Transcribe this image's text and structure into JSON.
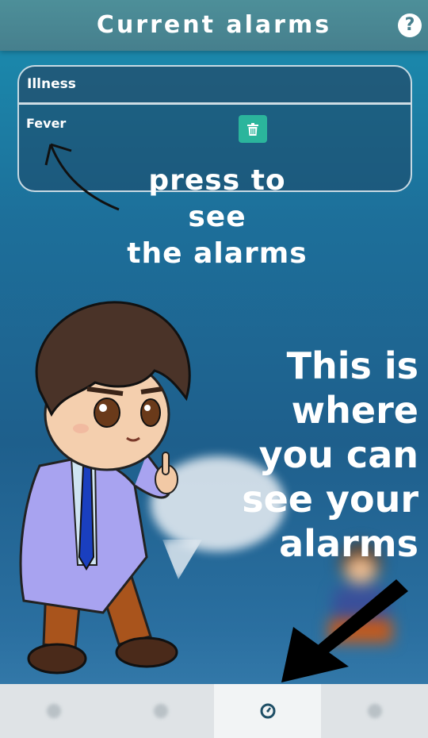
{
  "header": {
    "title": "Current alarms",
    "help_icon": "help-icon",
    "help_glyph": "?"
  },
  "card": {
    "section_title": "Illness",
    "alarms": [
      {
        "name": "Fever",
        "delete_icon": "trash-icon"
      }
    ]
  },
  "tutorial": {
    "hint_line1": "press to see",
    "hint_line2": "the alarms",
    "big_line1": "This is",
    "big_line2": "where",
    "big_line3": "you can",
    "big_line4": "see your",
    "big_line5": "alarms"
  },
  "bottom_nav": {
    "items": [
      {
        "icon": "home-icon",
        "active": false
      },
      {
        "icon": "calendar-icon",
        "active": false
      },
      {
        "icon": "alarm-clock-icon",
        "active": true
      },
      {
        "icon": "settings-icon",
        "active": false
      }
    ]
  },
  "colors": {
    "header_bg": "#467f8d",
    "delete_button": "#2bb59c",
    "nav_active_icon": "#1f4f66"
  }
}
